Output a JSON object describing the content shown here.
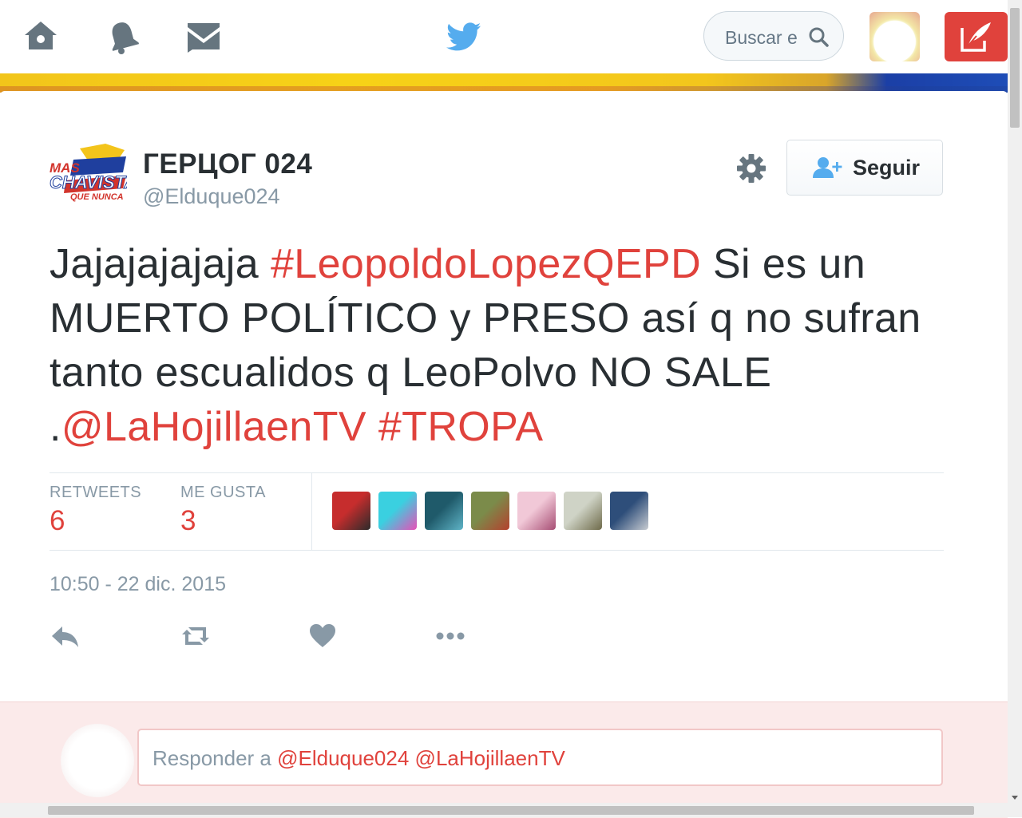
{
  "nav": {
    "home_icon": "home-icon",
    "notifications_icon": "bell-icon",
    "messages_icon": "envelope-icon",
    "logo_icon": "twitter-bird-icon",
    "search_placeholder": "Buscar e",
    "compose_icon": "quill-icon",
    "colors": {
      "bird": "#55acee",
      "nav_icon": "#66757f",
      "compose_bg": "#e0423c"
    }
  },
  "tweet": {
    "author": {
      "display_name": "ГЕРЦОГ 024",
      "handle": "@Elduque024",
      "avatar_text": [
        "MAS",
        "CHAVISTA",
        "QUE NUNCA"
      ]
    },
    "follow_label": "Seguir",
    "text_segments": [
      {
        "text": "Jajajajajaja ",
        "link": false
      },
      {
        "text": "#LeopoldoLopezQEPD",
        "link": true
      },
      {
        "text": " Si es un MUERTO POLÍTICO y PRESO así q no sufran tanto escualidos q LeoPolvo NO SALE .",
        "link": false
      },
      {
        "text": "@LaHojillaenTV",
        "link": true
      },
      {
        "text": " ",
        "link": false
      },
      {
        "text": "#TROPA",
        "link": true
      }
    ],
    "stats": {
      "retweets_label": "RETWEETS",
      "retweets_count": "6",
      "likes_label": "ME GUSTA",
      "likes_count": "3"
    },
    "likers": [
      {
        "name": "liker-avatar-1",
        "colors": [
          "#c62d2d",
          "#2b2b2b"
        ]
      },
      {
        "name": "liker-avatar-2",
        "colors": [
          "#3ad0e0",
          "#e84fb7"
        ]
      },
      {
        "name": "liker-avatar-3",
        "colors": [
          "#1f5a6a",
          "#5fb4c7"
        ]
      },
      {
        "name": "liker-avatar-4",
        "colors": [
          "#7b8b4a",
          "#b5402e"
        ]
      },
      {
        "name": "liker-avatar-5",
        "colors": [
          "#f1c8d7",
          "#a64d73"
        ]
      },
      {
        "name": "liker-avatar-6",
        "colors": [
          "#cfd3c6",
          "#6e6a4a"
        ]
      },
      {
        "name": "liker-avatar-7",
        "colors": [
          "#2e4e7a",
          "#c8ccd2"
        ]
      }
    ],
    "timestamp": "10:50 - 22 dic. 2015",
    "actions": [
      "reply-icon",
      "retweet-icon",
      "heart-icon",
      "more-icon"
    ]
  },
  "reply": {
    "prefix": "Responder a ",
    "mention_1": "@Elduque024",
    "mention_2": "@LaHojillaenTV"
  }
}
